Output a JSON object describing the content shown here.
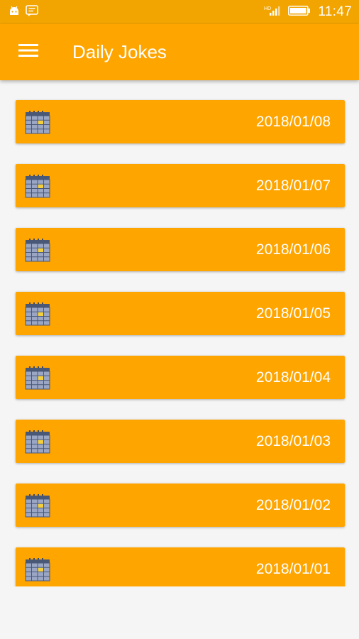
{
  "status_bar": {
    "time": "11:47",
    "icons": [
      "android-icon",
      "message-icon",
      "signal-icon",
      "battery-icon"
    ]
  },
  "app_bar": {
    "title": "Daily Jokes",
    "menu_icon": "hamburger-menu-icon"
  },
  "colors": {
    "primary": "#ffa500",
    "status_bar": "#f2a400",
    "background": "#f5f5f5",
    "text_on_primary": "#ffffff"
  },
  "items": [
    {
      "date": "2018/01/08",
      "icon": "calendar-icon"
    },
    {
      "date": "2018/01/07",
      "icon": "calendar-icon"
    },
    {
      "date": "2018/01/06",
      "icon": "calendar-icon"
    },
    {
      "date": "2018/01/05",
      "icon": "calendar-icon"
    },
    {
      "date": "2018/01/04",
      "icon": "calendar-icon"
    },
    {
      "date": "2018/01/03",
      "icon": "calendar-icon"
    },
    {
      "date": "2018/01/02",
      "icon": "calendar-icon"
    },
    {
      "date": "2018/01/01",
      "icon": "calendar-icon"
    }
  ]
}
